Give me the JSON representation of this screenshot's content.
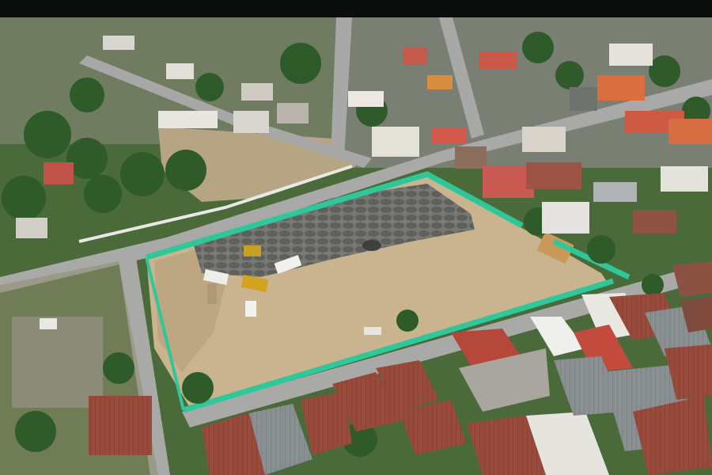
{
  "image": {
    "kind": "aerial-drone-photo",
    "palette": {
      "top_bar": "#0b0d0c",
      "vegetation_dark": "#2f5a2a",
      "vegetation_light": "#4e7b38",
      "dirt_lot": "#c9b48f",
      "dirt_dark": "#a89472",
      "gravel_piles": "#6f6f6d",
      "road": "#a9aaa7",
      "road_edge": "#8e8f8c",
      "fence_mesh": "#2ec79a",
      "roof_red": "#b5483a",
      "roof_rust": "#9a4a3b",
      "roof_orange": "#d76b3c",
      "roof_white": "#e6e6e2",
      "roof_grey": "#8a8f92",
      "building_white": "#e9e6df",
      "truck_yellow": "#d3a21d",
      "truck_white": "#f1f1ee"
    }
  }
}
